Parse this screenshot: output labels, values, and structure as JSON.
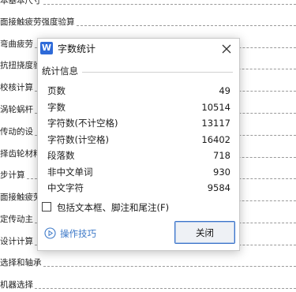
{
  "document": {
    "toc_lines": [
      "本基本尺寸",
      "面接触疲劳强度验算",
      "弯曲疲劳",
      "抗扭挠度验",
      "校核计算",
      "涡轮蜗杆",
      "传动的设",
      "择齿轮材料",
      "步计算",
      "面接触疲劳",
      "定传动主",
      "设计计算",
      "选择和轴承",
      "机器选择"
    ]
  },
  "dialog": {
    "app_icon_letter": "W",
    "title": "字数统计",
    "section_label": "统计信息",
    "stats": [
      {
        "label": "页数",
        "value": "49"
      },
      {
        "label": "字数",
        "value": "10514"
      },
      {
        "label": "字符数(不计空格)",
        "value": "13117"
      },
      {
        "label": "字符数(计空格)",
        "value": "16402"
      },
      {
        "label": "段落数",
        "value": "718"
      },
      {
        "label": "非中文单词",
        "value": "930"
      },
      {
        "label": "中文字符",
        "value": "9584"
      }
    ],
    "include_checkbox": {
      "label": "包括文本框、脚注和尾注(F)",
      "checked": false
    },
    "tips_label": "操作技巧",
    "close_button_label": "关闭"
  },
  "colors": {
    "accent": "#3b73c9",
    "link": "#3d79c8",
    "app_icon": "#2e6ad8"
  },
  "icons": {
    "close": "close-icon",
    "tips": "play-circle-icon",
    "app": "wps-writer-icon"
  }
}
